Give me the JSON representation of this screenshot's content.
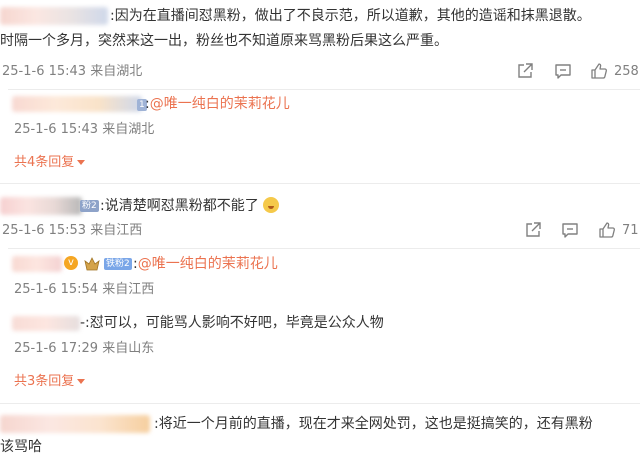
{
  "comments": [
    {
      "text_line1": ":因为在直播间怼黑粉，做出了不良示范，所以道歉，其他的造谣和抹黑退散。",
      "text_line2": "时隔一个多月，突然来这一出，粉丝也不知道原来骂黑粉后果这么严重。",
      "meta": "25-1-6 15:43 来自湖北",
      "like_count": "258",
      "reply": {
        "prefix": ":",
        "mention": "@唯一纯白的茉莉花儿",
        "meta": "25-1-6 15:43 来自湖北"
      },
      "more_replies": "共4条回复"
    },
    {
      "badge": "粉2",
      "text": ":说清楚啊怼黑粉都不能了",
      "emoji_name": "weary-face-emoji",
      "meta": "25-1-6 15:53 来自江西",
      "like_count": "71",
      "replies": [
        {
          "badge": "铁粉2",
          "prefix": ":",
          "mention": "@唯一纯白的茉莉花儿",
          "meta": "25-1-6 15:54 来自江西"
        },
        {
          "text": "-:怼可以，可能骂人影响不好吧，毕竟是公众人物",
          "meta": "25-1-6 17:29 来自山东"
        }
      ],
      "more_replies": "共3条回复"
    },
    {
      "text_line1": ":将近一个月前的直播，现在才来全网处罚，这也是挺搞笑的，还有黑粉",
      "text_line2": "该骂哈"
    }
  ],
  "icons": {
    "share": "share-icon",
    "comment": "comment-icon",
    "like": "thumbs-up-icon",
    "dropdown": "caret-down-icon"
  },
  "colors": {
    "accent": "#eb7350",
    "meta_gray": "#808080",
    "reply_bg": "#f2f2f2"
  }
}
